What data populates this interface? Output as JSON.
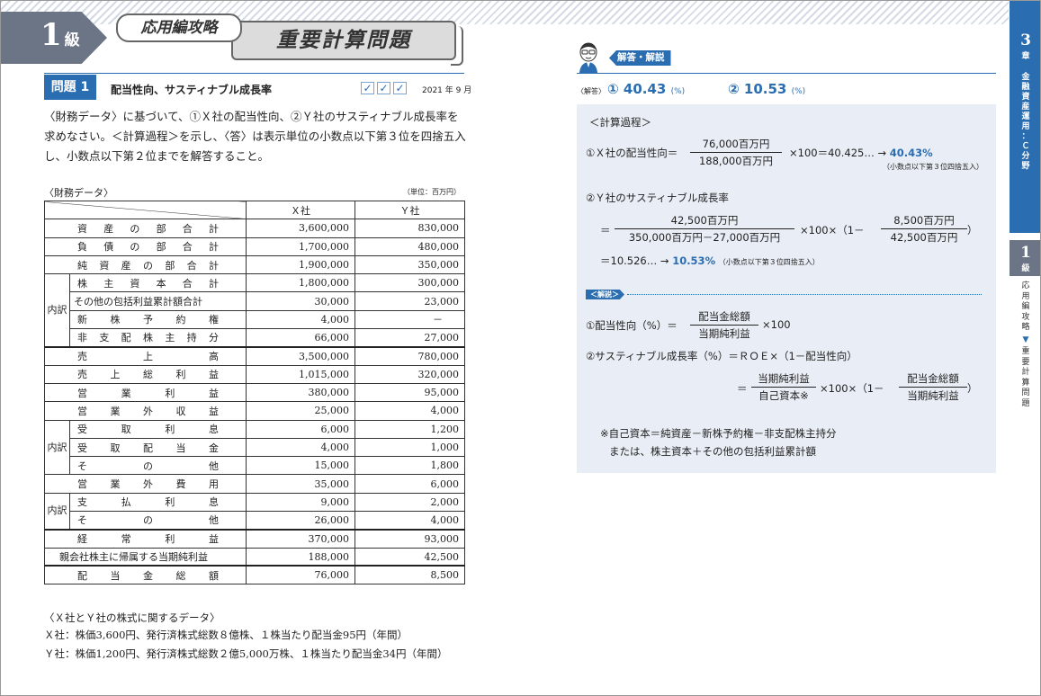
{
  "header": {
    "level_number": "1",
    "level_unit": "級",
    "category": "応用編攻略",
    "section_title": "重要計算問題"
  },
  "question": {
    "tag": "問題 1",
    "title": "配当性向、サスティナブル成長率",
    "checks": [
      "✓",
      "✓",
      "✓"
    ],
    "date": "2021 年 9 月",
    "body": "〈財務データ〉に基づいて、①Ｘ社の配当性向、②Ｙ社のサスティナブル成長率を求めなさい。＜計算過程＞を示し、〈答〉は表示単位の小数点以下第３位を四捨五入し、小数点以下第２位までを解答すること。"
  },
  "fin_table": {
    "label": "〈財務データ〉",
    "unit": "（単位：百万円）",
    "col_x": "Ｘ社",
    "col_y": "Ｙ社",
    "group_uchiwake": "内訳",
    "rows": [
      {
        "label": "資産の部合計",
        "x": "3,600,000",
        "y": "830,000"
      },
      {
        "label": "負債の部合計",
        "x": "1,700,000",
        "y": "480,000"
      },
      {
        "label": "純資産の部合計",
        "x": "1,900,000",
        "y": "350,000"
      },
      {
        "label": "株主資本合計",
        "x": "1,800,000",
        "y": "300,000"
      },
      {
        "label": "その他の包括利益累計額合計",
        "x": "30,000",
        "y": "23,000"
      },
      {
        "label": "新株予約権",
        "x": "4,000",
        "y": "－"
      },
      {
        "label": "非支配株主持分",
        "x": "66,000",
        "y": "27,000"
      },
      {
        "label": "売上高",
        "x": "3,500,000",
        "y": "780,000"
      },
      {
        "label": "売上総利益",
        "x": "1,015,000",
        "y": "320,000"
      },
      {
        "label": "営業利益",
        "x": "380,000",
        "y": "95,000"
      },
      {
        "label": "営業外収益",
        "x": "25,000",
        "y": "4,000"
      },
      {
        "label": "受取利息",
        "x": "6,000",
        "y": "1,200"
      },
      {
        "label": "受取配当金",
        "x": "4,000",
        "y": "1,000"
      },
      {
        "label": "その他",
        "x": "15,000",
        "y": "1,800"
      },
      {
        "label": "営業外費用",
        "x": "35,000",
        "y": "6,000"
      },
      {
        "label": "支払利息",
        "x": "9,000",
        "y": "2,000"
      },
      {
        "label": "その他",
        "x": "26,000",
        "y": "4,000"
      },
      {
        "label": "経常利益",
        "x": "370,000",
        "y": "93,000"
      },
      {
        "label": "親会社株主に帰属する当期純利益",
        "x": "188,000",
        "y": "42,500"
      },
      {
        "label": "配当金総額",
        "x": "76,000",
        "y": "8,500"
      }
    ]
  },
  "stock": {
    "heading": "〈Ｘ社とＹ社の株式に関するデータ〉",
    "x_line": "Ｘ社：株価3,600円、発行済株式総数８億株、１株当たり配当金95円（年間）",
    "y_line": "Ｙ社：株価1,200円、発行済株式総数２億5,000万株、１株当たり配当金34円（年間）"
  },
  "answer": {
    "kaitou_tag": "解答・解説",
    "ans_tag": "〈解答〉",
    "a1": "① 40.43",
    "a1_unit": "(%)",
    "a2": "② 10.53",
    "a2_unit": "(%)"
  },
  "calc": {
    "heading": "＜計算過程＞",
    "x_lhs": "①Ｘ社の配当性向＝",
    "x_num": "76,000百万円",
    "x_den": "188,000百万円",
    "x_rest": "×100＝40.425… →",
    "x_result": "40.43%",
    "rounding1": "（小数点以下第３位四捨五入）",
    "y_title": "②Ｙ社のサスティナブル成長率",
    "eq": "＝",
    "y_num": "42,500百万円",
    "y_den": "350,000百万円－27,000百万円",
    "y_mid": "×100×（1－",
    "y_num2": "8,500百万円",
    "y_den2": "42,500百万円",
    "close": "）",
    "y_eq2": "＝10.526… →",
    "y_result": "10.53%",
    "rounding2": "（小数点以下第３位四捨五入）",
    "kaisetsu_tag": "＜解説＞",
    "f1_lhs": "①配当性向（%）＝",
    "f1_num": "配当金総額",
    "f1_den": "当期純利益",
    "f1_rest": "×100",
    "f2_line": "②サスティナブル成長率（%）＝ＲＯＥ×（1－配当性向）",
    "f2_num": "当期純利益",
    "f2_den": "自己資本※",
    "f2_mid": "×100×（1－",
    "f2_num2": "配当金総額",
    "f2_den2": "当期純利益",
    "note1": "※自己資本＝純資産－新株予約権－非支配株主持分",
    "note2": "または、株主資本＋その他の包括利益累計額"
  },
  "side": {
    "chapter_num": "3",
    "chapter_unit": "章",
    "chapter_title": "金融資産運用：Ｃ分野",
    "level_num": "1",
    "level_unit": "級",
    "nav_top": "応用編攻略",
    "nav_arrow": "▼",
    "nav_bottom": "重要計算問題"
  }
}
